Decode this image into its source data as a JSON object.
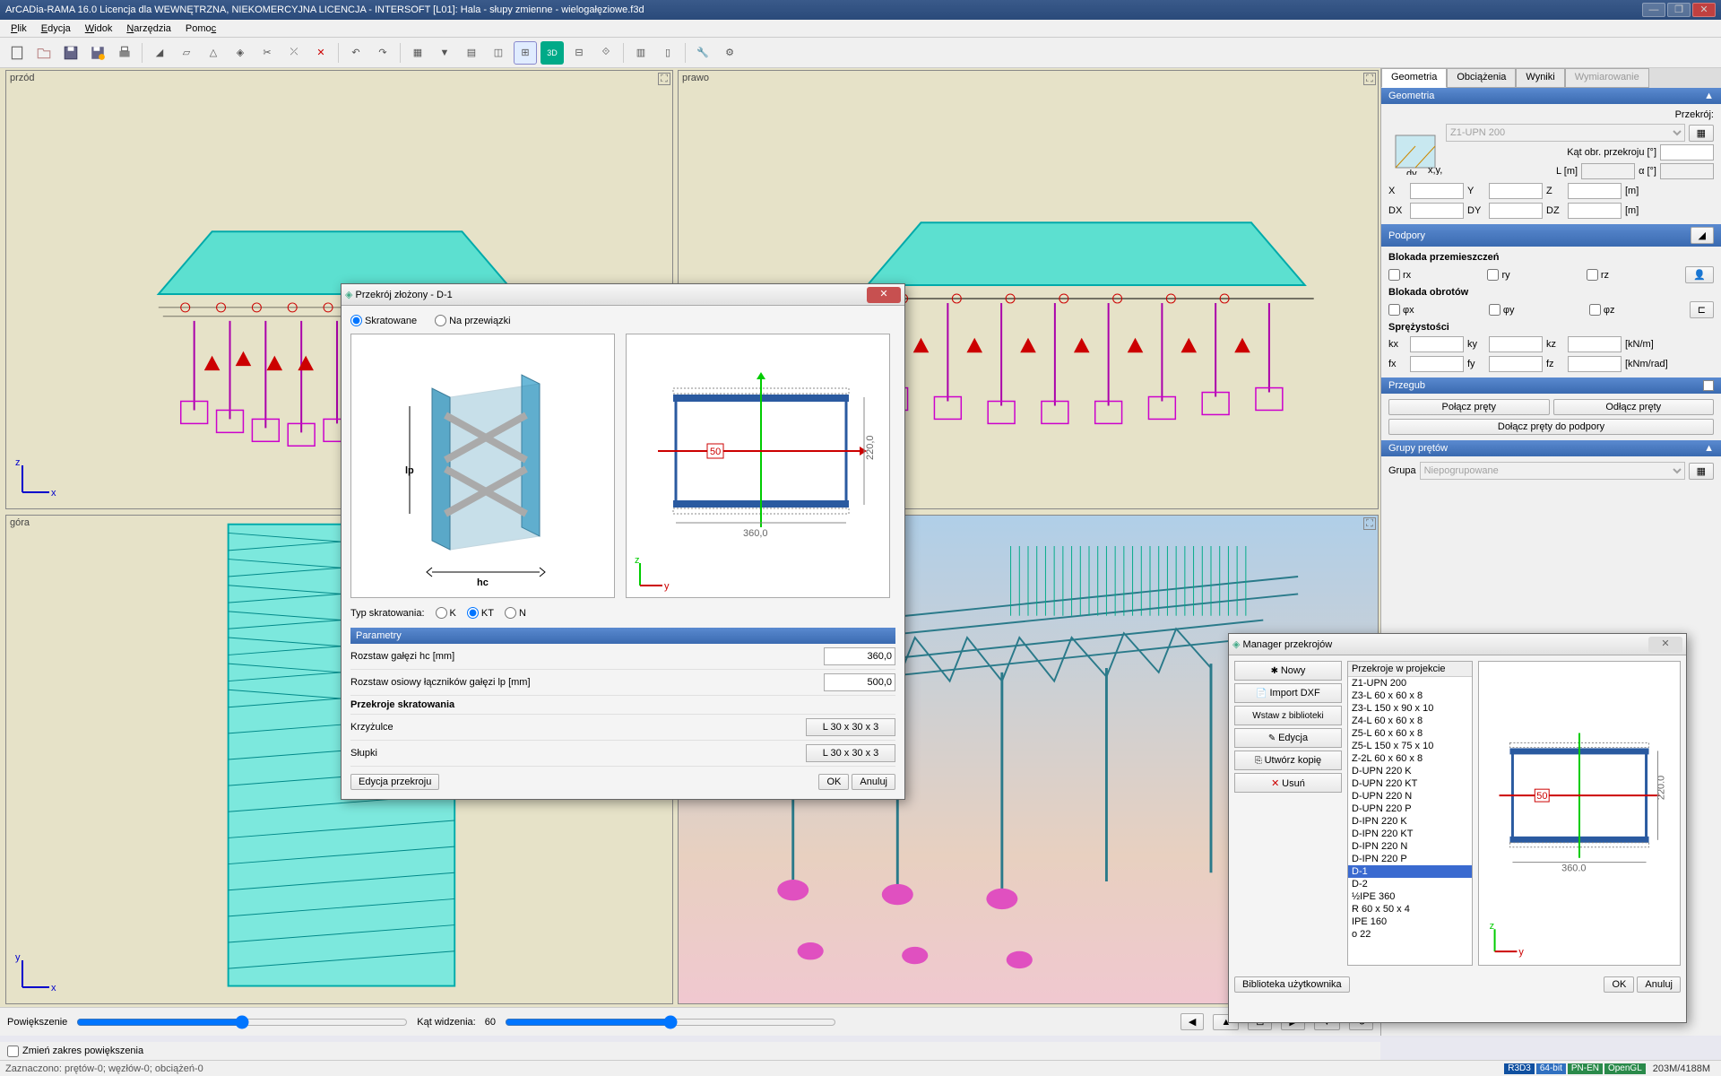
{
  "title": "ArCADia-RAMA 16.0 Licencja dla WEWNĘTRZNA, NIEKOMERCYJNA LICENCJA - INTERSOFT [L01]: Hala - słupy zmienne - wielogałęziowe.f3d",
  "menu": [
    "Plik",
    "Edycja",
    "Widok",
    "Narzędzia",
    "Pomoc"
  ],
  "viewports": {
    "v1": "przód",
    "v2": "prawo",
    "v3": "góra",
    "v4": ""
  },
  "bottom": {
    "zoom_label": "Powiększenie",
    "angle_label": "Kąt widzenia:",
    "angle_value": "60",
    "chk": "Zmień zakres powiększenia",
    "status": "Zaznaczono: prętów-0;  węzłów-0;  obciążeń-0"
  },
  "statusbar": {
    "tags": [
      "R3D3",
      "64-bit",
      "PN-EN",
      "OpenGL"
    ],
    "mem": "203M/4188M"
  },
  "sidetabs": [
    "Geometria",
    "Obciążenia",
    "Wyniki",
    "Wymiarowanie"
  ],
  "geom": {
    "head": "Geometria",
    "przekroj_label": "Przekrój:",
    "przekroj_value": "Z1-UPN 200",
    "kat_label": "Kąt obr. przekroju [°]",
    "L_label": "L [m]",
    "alpha_label": "α [°]",
    "coords": [
      "X",
      "Y",
      "Z"
    ],
    "dcoords": [
      "DX",
      "DY",
      "DZ"
    ],
    "m": "[m]"
  },
  "podpory": {
    "head": "Podpory",
    "blok_p": "Blokada przemieszczeń",
    "blok_o": "Blokada obrotów",
    "sprez": "Sprężystości",
    "units1": "[kN/m]",
    "units2": "[kNm/rad]",
    "sub": [
      "rx",
      "ry",
      "rz"
    ],
    "sub2": [
      "φx",
      "φy",
      "φz"
    ],
    "k": [
      "kx",
      "ky",
      "kz"
    ],
    "f": [
      "fx",
      "fy",
      "fz"
    ]
  },
  "przegub": {
    "head": "Przegub",
    "b1": "Połącz pręty",
    "b2": "Odłącz pręty",
    "b3": "Dołącz pręty do podpory"
  },
  "grupy": {
    "head": "Grupy prętów",
    "label": "Grupa",
    "value": "Niepogrupowane"
  },
  "dlg1": {
    "title": "Przekrój złożony - D-1",
    "r1": "Skratowane",
    "r2": "Na przewiązki",
    "typ_label": "Typ skratowania:",
    "typ": [
      "K",
      "KT",
      "N"
    ],
    "params": "Parametry",
    "p1": "Rozstaw gałęzi hc [mm]",
    "p1v": "360,0",
    "p2": "Rozstaw osiowy łączników gałęzi lp [mm]",
    "p2v": "500,0",
    "p3": "Przekroje skratowania",
    "p4": "Krzyżulce",
    "p4v": "L 30 x 30 x 3",
    "p5": "Słupki",
    "p5v": "L 30 x 30 x 3",
    "edit": "Edycja przekroju",
    "ok": "OK",
    "cancel": "Anuluj",
    "dim1": "360,0",
    "dim2": "220,0"
  },
  "dlg2": {
    "title": "Manager przekrojów",
    "btns": [
      "Nowy",
      "Import DXF",
      "Wstaw z biblioteki",
      "Edycja",
      "Utwórz kopię",
      "Usuń"
    ],
    "listhead": "Przekroje w projekcie",
    "items": [
      "Z1-UPN 200",
      "Z3-L 60 x 60 x 8",
      "Z3-L 150 x 90 x 10",
      "Z4-L 60 x 60 x 8",
      "Z5-L 60 x 60 x 8",
      "Z5-L 150 x 75 x 10",
      "Z-2L 60 x 60 x 8",
      "D-UPN 220 K",
      "D-UPN 220 KT",
      "D-UPN 220 N",
      "D-UPN 220 P",
      "D-IPN 220 K",
      "D-IPN 220 KT",
      "D-IPN 220 N",
      "D-IPN 220 P",
      "D-1",
      "D-2",
      "½IPE 360",
      "R 60 x 50 x 4",
      "IPE 160",
      "o 22"
    ],
    "selected": "D-1",
    "lib": "Biblioteka użytkownika",
    "ok": "OK",
    "cancel": "Anuluj",
    "dim1": "360.0",
    "dim2": "220.0"
  }
}
